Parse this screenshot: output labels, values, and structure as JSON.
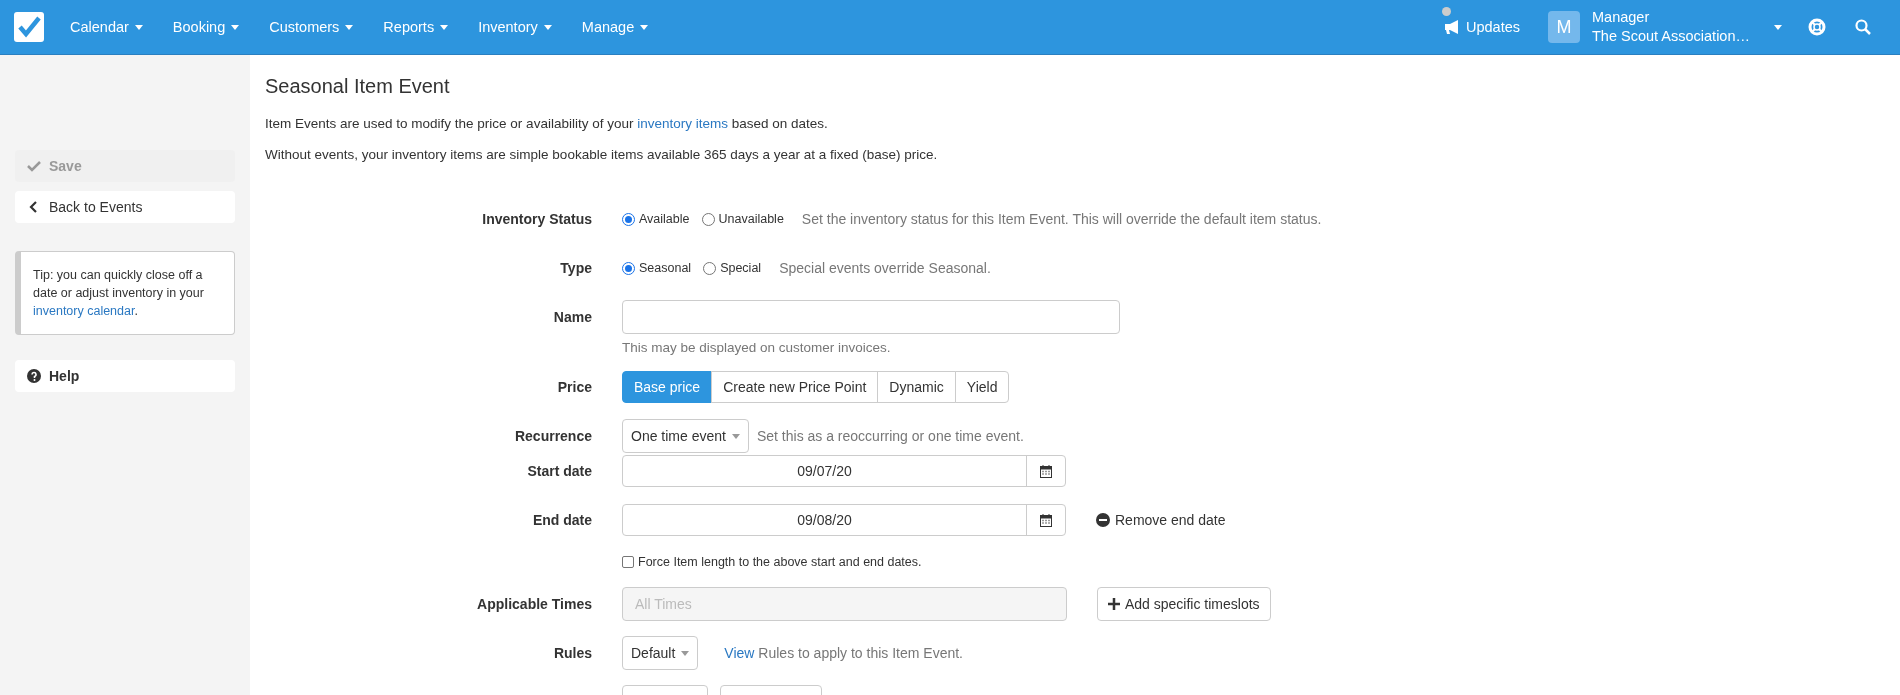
{
  "nav": {
    "items": [
      {
        "label": "Calendar"
      },
      {
        "label": "Booking"
      },
      {
        "label": "Customers"
      },
      {
        "label": "Reports"
      },
      {
        "label": "Inventory"
      },
      {
        "label": "Manage"
      }
    ],
    "updates": {
      "label": "Updates"
    },
    "user": {
      "initial": "M",
      "name": "Manager",
      "org": "The Scout Association…"
    }
  },
  "sidebar": {
    "save": {
      "label": "Save",
      "disabled": true
    },
    "back": {
      "label": "Back to Events"
    },
    "tip": {
      "text": "Tip: you can quickly close off a date or adjust inventory in your ",
      "link": "inventory calendar",
      "after": "."
    },
    "help": {
      "label": "Help"
    }
  },
  "page": {
    "title": "Seasonal Item Event",
    "intro": [
      {
        "text": "Item Events are used to modify the price or availability of your ",
        "link": "inventory items",
        "after": " based on dates."
      },
      {
        "text": "Without events, your inventory items are simple bookable items available 365 days a year at a fixed (base) price."
      }
    ]
  },
  "form": [
    {
      "kind": "radio",
      "label": "Inventory Status",
      "options": [
        {
          "label": "Available",
          "selected": true
        },
        {
          "label": "Unavailable",
          "selected": false
        }
      ],
      "help": "Set the inventory status for this Item Event. This will override the default item status."
    },
    {
      "kind": "radio",
      "label": "Type",
      "options": [
        {
          "label": "Seasonal",
          "selected": true
        },
        {
          "label": "Special",
          "selected": false
        }
      ],
      "help": "Special events override Seasonal."
    },
    {
      "kind": "text",
      "label": "Name",
      "hint": "This may be displayed on customer invoices."
    },
    {
      "kind": "segmented",
      "label": "Price",
      "options": [
        {
          "label": "Base price",
          "selected": true
        },
        {
          "label": "Create new Price Point",
          "selected": false
        },
        {
          "label": "Dynamic",
          "selected": false
        },
        {
          "label": "Yield",
          "selected": false
        }
      ]
    },
    {
      "kind": "dropdown",
      "label": "Recurrence",
      "value": "One time event",
      "help": "Set this as a reoccurring or one time event."
    },
    {
      "kind": "date",
      "label": "Start date",
      "value": "09/07/20"
    },
    {
      "kind": "date",
      "label": "End date",
      "value": "09/08/20",
      "action": "Remove end date"
    },
    {
      "kind": "checkbox",
      "label": "Force Item length to the above start and end dates.",
      "checked": false
    },
    {
      "kind": "readonly",
      "label": "Applicable Times",
      "placeholder": "All Times",
      "action": "Add specific timeslots"
    },
    {
      "kind": "dropdown",
      "label": "Rules",
      "value": "Default",
      "link": "View",
      "help": "Rules to apply to this Item Event."
    },
    {
      "kind": "partial_buttons"
    }
  ]
}
